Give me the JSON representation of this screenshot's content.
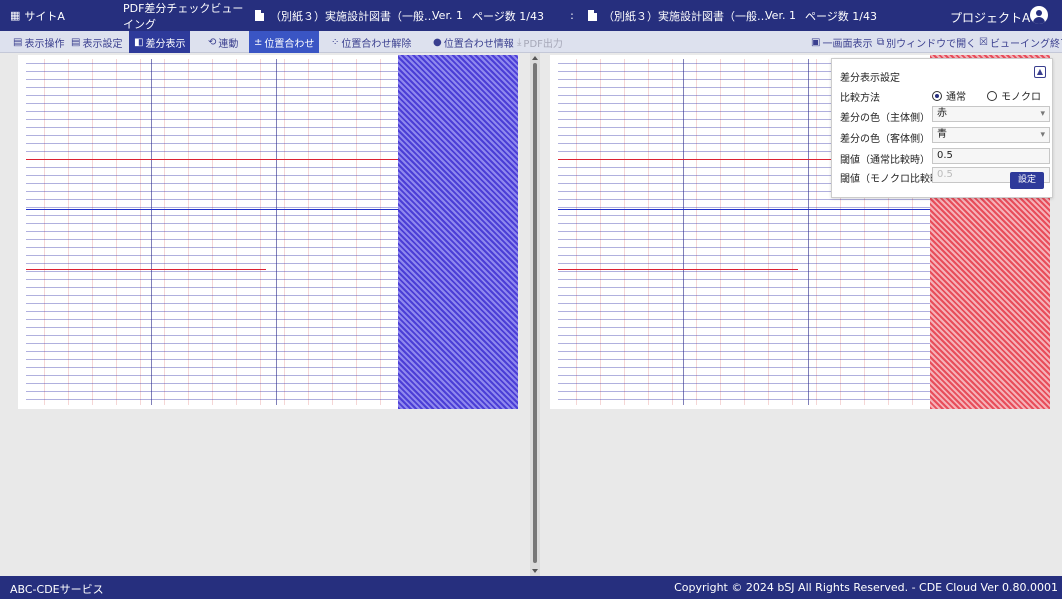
{
  "topbar": {
    "site_icon": "grid-icon",
    "site_label": "サイトA",
    "app_title": "PDF差分チェックビューイング",
    "left_doc": {
      "icon": "file-icon",
      "name": "（別紙３）実施設計図書（一般…",
      "version": "Ver. 1",
      "pages": "ページ数 1/43"
    },
    "separator": ":",
    "right_doc": {
      "icon": "file-icon",
      "name": "（別紙３）実施設計図書（一般…",
      "version": "Ver. 1",
      "pages": "ページ数 1/43"
    },
    "project": "プロジェクトA",
    "user_icon": "user-icon"
  },
  "toolbar": {
    "display_op": "表示操作",
    "display_settings": "表示設定",
    "diff_display": "差分表示",
    "link": "連動",
    "align": "位置合わせ",
    "align_release": "位置合わせ解除",
    "align_info": "位置合わせ情報",
    "pdf_output": "PDF出力",
    "single_view": "一画面表示",
    "new_window": "別ウィンドウで開く",
    "end_viewing": "ビューイング終了"
  },
  "settings": {
    "title": "差分表示設定",
    "compare_label": "比較方法",
    "mode_normal": "通常",
    "mode_mono": "モノクロ",
    "subject_color_label": "差分の色（主体側）",
    "subject_color_value": "赤",
    "object_color_label": "差分の色（客体側）",
    "object_color_value": "青",
    "threshold_normal_label": "閾値（通常比較時）",
    "threshold_normal_value": "0.5",
    "threshold_mono_label": "閾値（モノクロ比較時）",
    "threshold_mono_value": "0.5",
    "apply": "設定",
    "collapse_icon": "chevron-up-icon"
  },
  "colors": {
    "brand": "#262f7e",
    "subject_diff": "#e84d5a",
    "object_diff": "#4b3ed6"
  },
  "footer": {
    "service": "ABC-CDEサービス",
    "copyright": "Copyright © 2024 bSJ All Rights Reserved. - CDE Cloud Ver 0.80.0001"
  }
}
